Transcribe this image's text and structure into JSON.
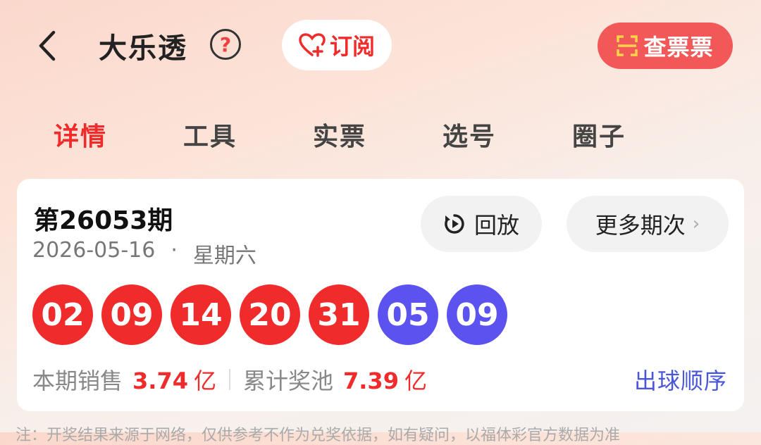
{
  "header": {
    "back_icon": "chevron-left-icon",
    "title": "大乐透",
    "help_icon": "question-circle-icon",
    "help_glyph": "?",
    "subscribe_label": "订阅",
    "subscribe_icon": "heart-plus-icon",
    "check_ticket_label": "查票票",
    "check_ticket_icon": "scan-icon"
  },
  "tabs": [
    {
      "label": "详情",
      "active": true
    },
    {
      "label": "工具",
      "active": false
    },
    {
      "label": "实票",
      "active": false
    },
    {
      "label": "选号",
      "active": false
    },
    {
      "label": "圈子",
      "active": false
    }
  ],
  "draw": {
    "issue": "第26053期",
    "date": "2026-05-16",
    "separator": "·",
    "weekday": "星期六",
    "replay_label": "回放",
    "replay_icon": "replay-icon",
    "more_label": "更多期次",
    "more_chevron": "›",
    "red_balls": [
      "02",
      "09",
      "14",
      "20",
      "31"
    ],
    "blue_balls": [
      "05",
      "09"
    ],
    "sales_label": "本期销售",
    "sales_value": "3.74",
    "sales_unit": "亿",
    "pool_label": "累计奖池",
    "pool_value": "7.39",
    "pool_unit": "亿",
    "order_link": "出球顺序"
  },
  "footnote": "注：开奖结果来源于网络，仅供参考不作为兑奖依据，如有疑问，以福体彩官方数据为准",
  "colors": {
    "accent_red": "#ef2b2b",
    "ball_blue": "#5b52f0",
    "link_blue": "#4a56d9",
    "check_ticket_bg": "#f25858"
  }
}
